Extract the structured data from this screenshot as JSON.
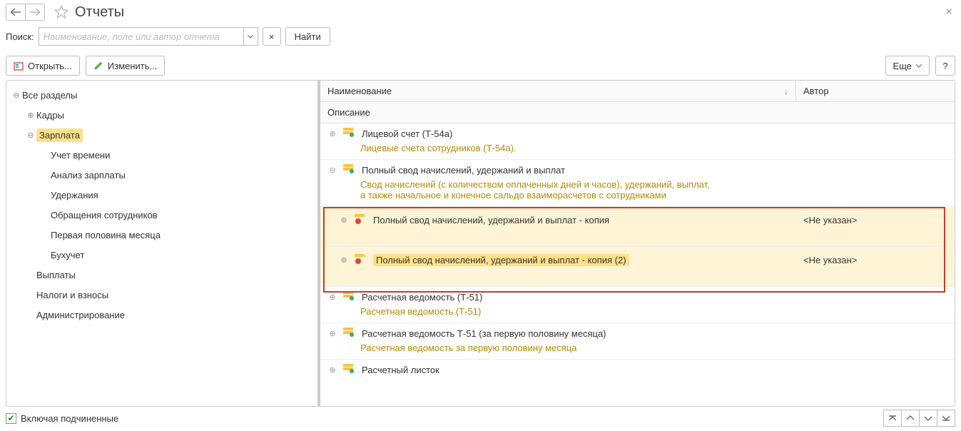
{
  "title": "Отчеты",
  "search": {
    "label": "Поиск:",
    "placeholder": "Наименование, поле или автор отчета",
    "find": "Найти",
    "clear": "×"
  },
  "toolbar": {
    "open": "Открыть...",
    "edit": "Изменить...",
    "more": "Еще",
    "help": "?"
  },
  "tree": {
    "root": "Все разделы",
    "kadry": "Кадры",
    "zarplata": "Зарплата",
    "uchet": "Учет времени",
    "analiz": "Анализ зарплаты",
    "uderzh": "Удержания",
    "obrash": "Обращения сотрудников",
    "pervaya": "Первая половина месяца",
    "buhuchet": "Бухучет",
    "vyplaty": "Выплаты",
    "nalogi": "Налоги и взносы",
    "admin": "Администрирование"
  },
  "cols": {
    "name": "Наименование",
    "author": "Автор",
    "desc": "Описание"
  },
  "items": {
    "licevoy": {
      "name": "Лицевой счет (Т-54а)",
      "desc": "Лицевые счета сотрудников (Т-54а)."
    },
    "svod": {
      "name": "Полный свод начислений, удержаний и выплат",
      "desc": "Свод начислений (с количеством оплаченных дней и часов), удержаний, выплат,\nа также начальное и конечное сальдо взаиморасчетов с сотрудниками"
    },
    "copy1": {
      "name": "Полный свод начислений, удержаний и выплат - копия",
      "author": "<Не указан>"
    },
    "copy2": {
      "name": "Полный свод начислений, удержаний и выплат - копия (2)",
      "author": "<Не указан>"
    },
    "rasch_t51": {
      "name": "Расчетная ведомость (Т-51)",
      "desc": "Расчетная ведомость (Т-51)"
    },
    "rasch_half": {
      "name": "Расчетная ведомость Т-51 (за первую половину месяца)",
      "desc": "Расчетная ведомость за первую половину месяца"
    },
    "listok": {
      "name": "Расчетный листок"
    }
  },
  "footer": {
    "include": "Включая подчиненные"
  }
}
